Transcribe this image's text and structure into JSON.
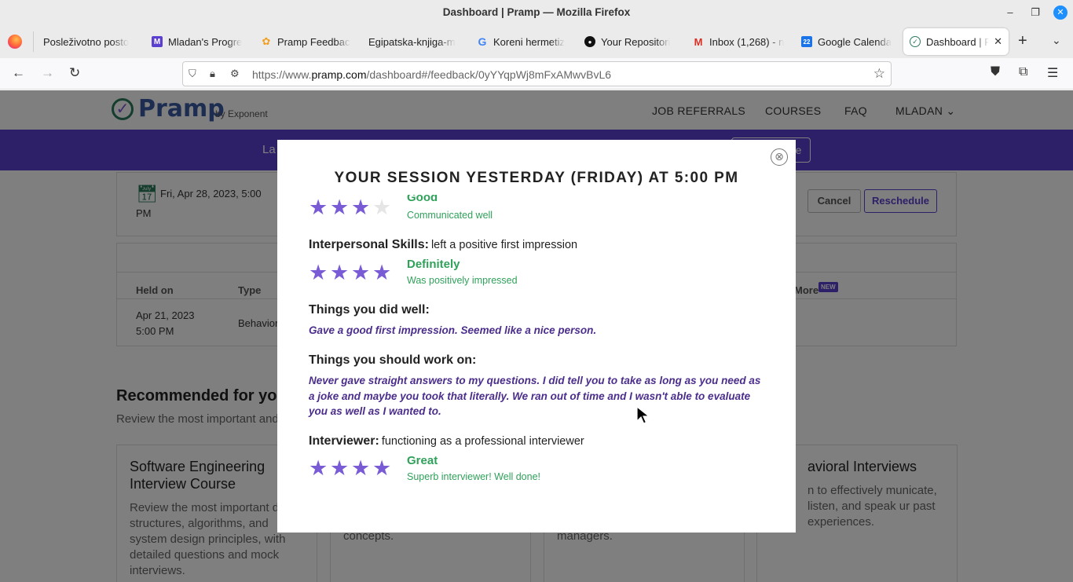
{
  "window": {
    "title": "Dashboard | Pramp — Mozilla Firefox",
    "controls": {
      "minimize": "–",
      "maximize": "❐",
      "close": "✕"
    }
  },
  "tabs": [
    {
      "label": "Posleživotno posto",
      "favicon": "none",
      "color": "#ebebeb"
    },
    {
      "label": "Mladan's Progre",
      "favicon": "M",
      "color": "#5b3fd0"
    },
    {
      "label": "Pramp Feedbac",
      "favicon": "✿",
      "color": "#f29e1f"
    },
    {
      "label": "Egipatska-knjiga-m",
      "favicon": "none",
      "color": "#ebebeb"
    },
    {
      "label": "Koreni hermetiz",
      "favicon": "G",
      "color": "#4285f4"
    },
    {
      "label": "Your Repositori",
      "favicon": "●",
      "color": "#111111"
    },
    {
      "label": "Inbox (1,268) - n",
      "favicon": "M",
      "color": "#d93025"
    },
    {
      "label": "Google Calenda",
      "favicon": "22",
      "color": "#1a73e8"
    },
    {
      "label": "Dashboard | P",
      "favicon": "✓",
      "color": "#2b7a5c",
      "active": true
    }
  ],
  "navbar": {
    "url_prefix": "https://www.",
    "url_host": "pramp.com",
    "url_path": "/dashboard#/feedback/0yYYqpWj8mFxAMwvBvL6"
  },
  "site": {
    "logo": "Pramp",
    "logo_by": "by Exponent",
    "nav": [
      "JOB REFERRALS",
      "COURSES",
      "FAQ",
      "MLADAN"
    ],
    "banner_text": "La",
    "banner_button": "e",
    "session_date": "Fri, Apr 28, 2023, 5:00",
    "session_date_2": "PM",
    "cancel": "Cancel",
    "reschedule": "Reschedule",
    "table_headers": {
      "held_on": "Held on",
      "type": "Type",
      "more": "More",
      "new_badge": "NEW"
    },
    "row": {
      "date": "Apr 21, 2023",
      "time": "5:00 PM",
      "type": "Behavior"
    },
    "recommended_title": "Recommended for you",
    "recommended_sub": "Review the most important and",
    "courses": [
      {
        "title": "Software Engineering Interview Course",
        "desc": "Review the most important d structures, algorithms, and system design principles, with detailed questions and mock interviews."
      },
      {
        "title": "",
        "desc": "video examples and fundamental concepts."
      },
      {
        "title": "",
        "desc": "examples and strategies from top managers."
      },
      {
        "title": "avioral Interviews",
        "desc": "n to effectively municate, listen, and speak ur past experiences."
      }
    ]
  },
  "modal": {
    "title": "YOUR SESSION YESTERDAY (FRIDAY) AT 5:00 PM",
    "close_icon": "⊗",
    "ratings": [
      {
        "heading": "",
        "question": "",
        "stars": 3,
        "label": "Good",
        "desc": "Communicated well"
      },
      {
        "heading": "Interpersonal Skills:",
        "question": "left a positive first impression",
        "stars": 4,
        "label": "Definitely",
        "desc": "Was positively impressed"
      },
      {
        "heading": "Interviewer:",
        "question": "functioning as a professional interviewer",
        "stars": 4,
        "label": "Great",
        "desc": "Superb interviewer! Well done!"
      }
    ],
    "did_well_heading": "Things you did well:",
    "did_well_text": "Gave a good first impression. Seemed like a nice person.",
    "work_on_heading": "Things you should work on:",
    "work_on_text": "Never gave straight answers to my questions. I did tell you to take as long as you need as a joke and maybe you took that literally. We ran out of time and I wasn't able to evaluate you as well as I wanted to.",
    "star_color": "#7a5bd6",
    "rating_color": "#2fa15a",
    "comment_color": "#4b2e8c"
  }
}
